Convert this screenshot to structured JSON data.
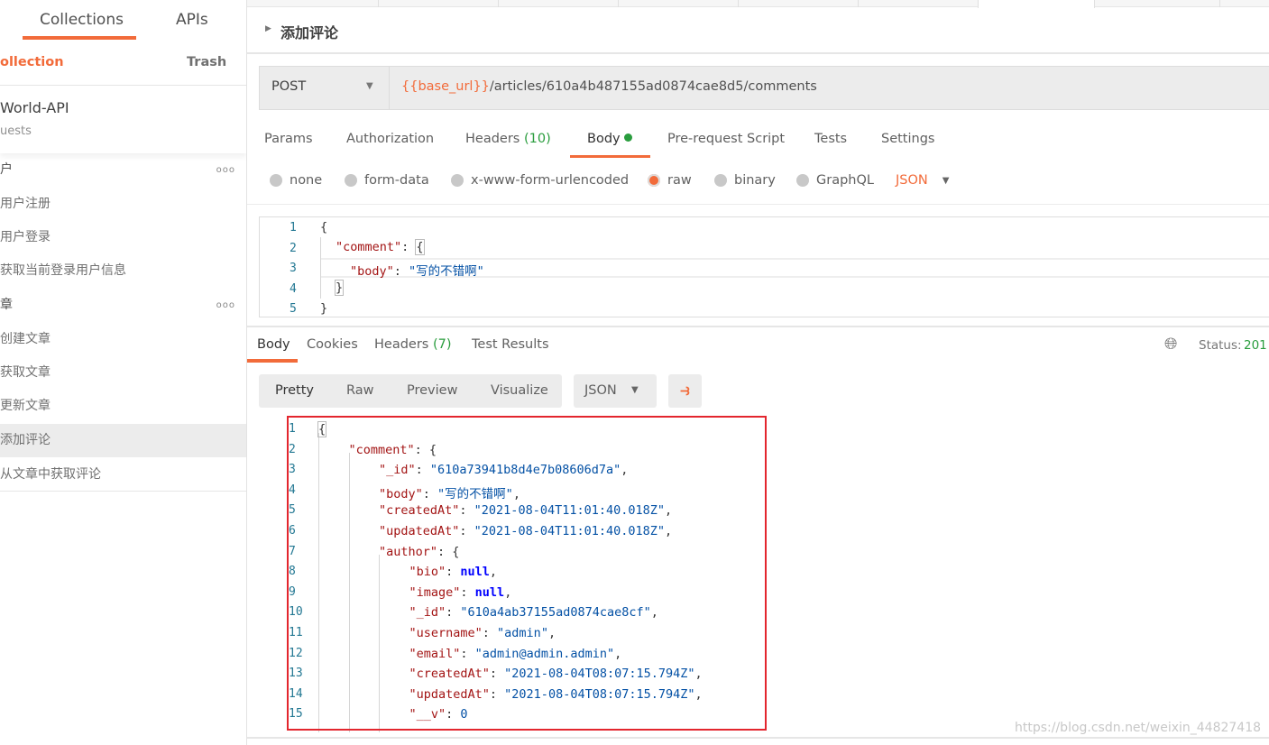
{
  "sidebar": {
    "tabs": [
      {
        "label": "Collections",
        "active": true
      },
      {
        "label": "APIs"
      }
    ],
    "new_collection": "ollection",
    "trash": "Trash",
    "collection_name": "World-API",
    "collection_sub": "uests",
    "items": [
      {
        "label": "户",
        "type": "folder"
      },
      {
        "label": "用户注册"
      },
      {
        "label": "用户登录"
      },
      {
        "label": "获取当前登录用户信息"
      },
      {
        "label": "章",
        "type": "folder"
      },
      {
        "label": "创建文章"
      },
      {
        "label": "获取文章"
      },
      {
        "label": "更新文章"
      },
      {
        "label": "添加评论",
        "selected": true
      },
      {
        "label": "从文章中获取评论"
      }
    ]
  },
  "request": {
    "name": "添加评论",
    "method": "POST",
    "url_var": "{{base_url}}",
    "url_path": "/articles/610a4b487155ad0874cae8d5/comments",
    "tabs": [
      {
        "label": "Params"
      },
      {
        "label": "Authorization"
      },
      {
        "label": "Headers",
        "count": "(10)"
      },
      {
        "label": "Body",
        "active": true
      },
      {
        "label": "Pre-request Script"
      },
      {
        "label": "Tests"
      },
      {
        "label": "Settings"
      }
    ],
    "body_modes": [
      "none",
      "form-data",
      "x-www-form-urlencoded",
      "raw",
      "binary",
      "GraphQL"
    ],
    "selected_mode": "raw",
    "format": "JSON",
    "body_lines": [
      "1",
      "2",
      "3",
      "4",
      "5"
    ]
  },
  "response": {
    "tabs": [
      {
        "label": "Body",
        "active": true
      },
      {
        "label": "Cookies"
      },
      {
        "label": "Headers",
        "count": "(7)"
      },
      {
        "label": "Test Results"
      }
    ],
    "status_label": "Status:",
    "status_value": "201",
    "views": [
      "Pretty",
      "Raw",
      "Preview",
      "Visualize"
    ],
    "format": "JSON"
  },
  "watermark": "https://blog.csdn.net/weixin_44827418",
  "colors": {
    "accent": "#f26b3a",
    "highlight_box": "#e3262e",
    "green": "#2a9d3e"
  }
}
